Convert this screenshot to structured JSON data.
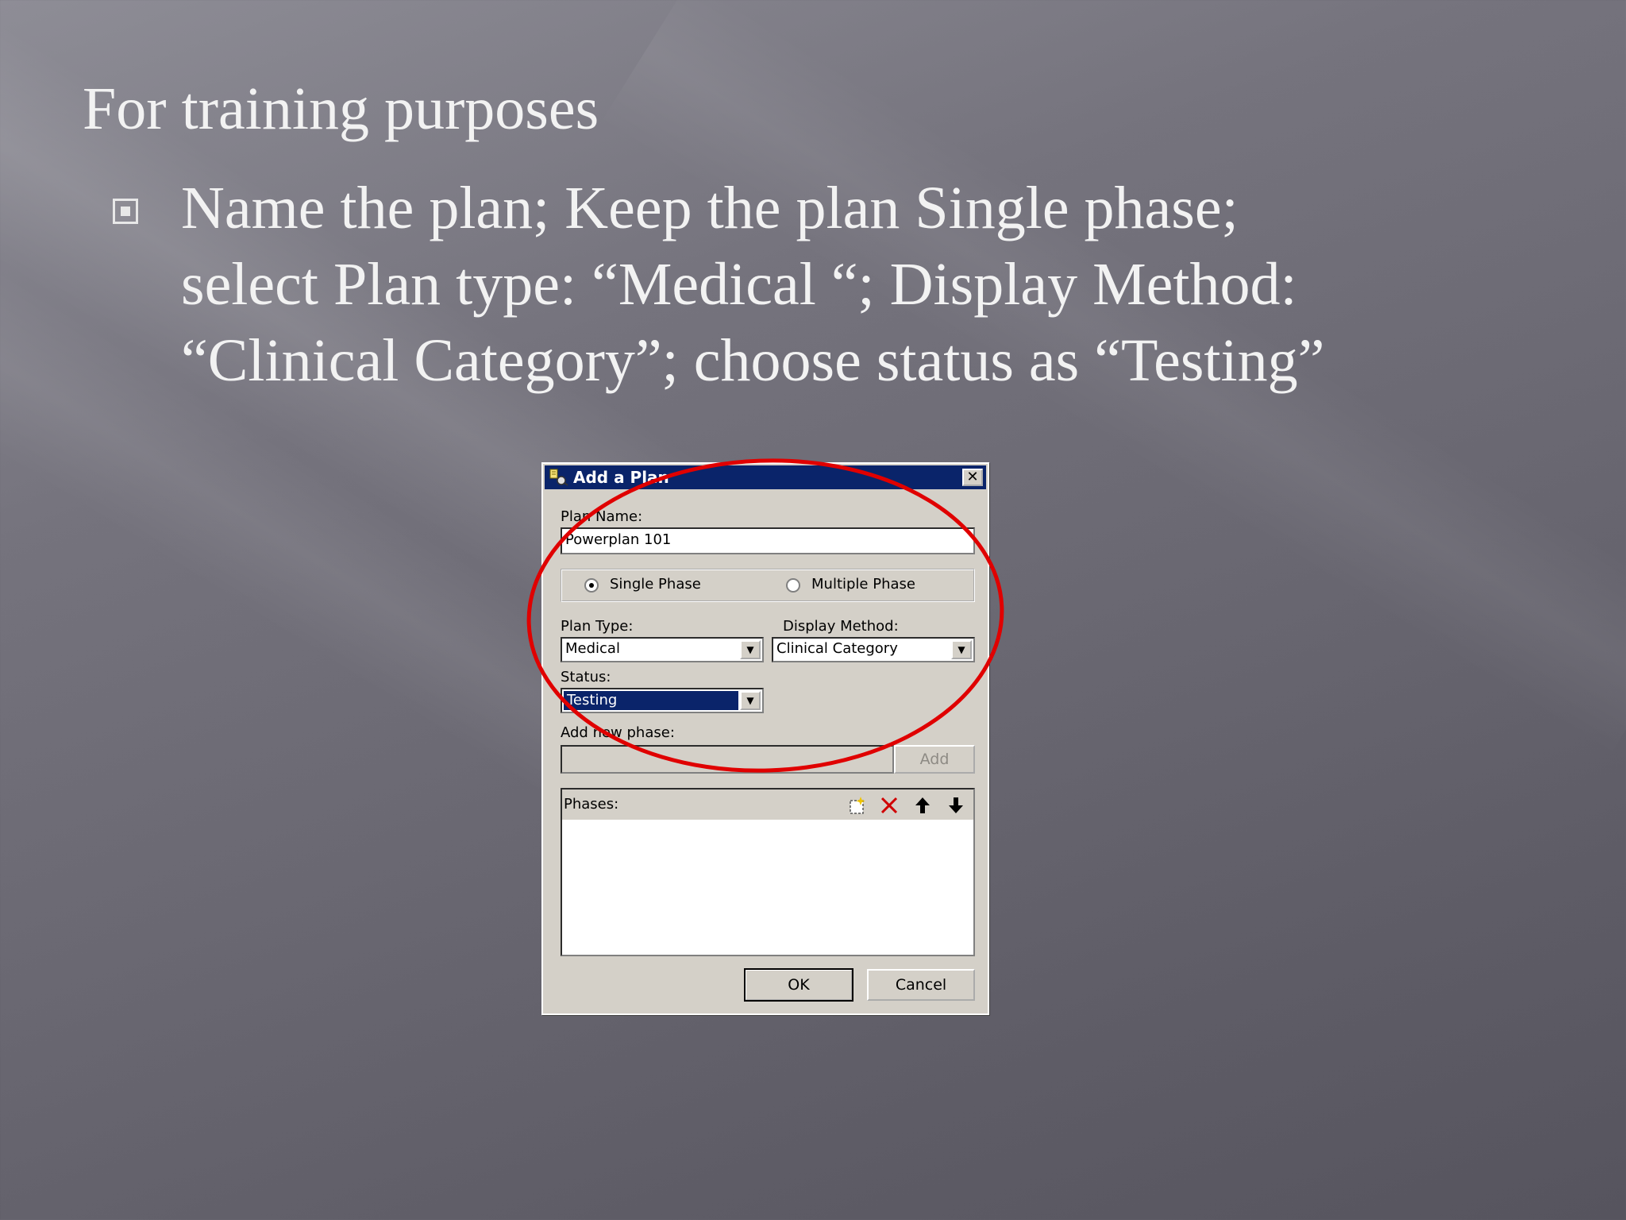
{
  "slide": {
    "title": "For training purposes",
    "bullet_lines": [
      "Name the plan; Keep the plan Single phase;",
      "select Plan type: “Medical “; Display Method:",
      "“Clinical Category”; choose status as “Testing”"
    ]
  },
  "dialog": {
    "title": "Add a Plan",
    "plan_name_label": "Plan Name:",
    "plan_name_value": "Powerplan 101",
    "single_phase_label": "Single Phase",
    "multiple_phase_label": "Multiple Phase",
    "selected_phase_mode": "Single Phase",
    "plan_type_label": "Plan Type:",
    "plan_type_value": "Medical",
    "display_method_label": "Display Method:",
    "display_method_value": "Clinical Category",
    "status_label": "Status:",
    "status_value": "Testing",
    "add_phase_label": "Add new phase:",
    "add_phase_value": "",
    "add_button": "Add",
    "phases_label": "Phases:",
    "ok_button": "OK",
    "cancel_button": "Cancel",
    "icons": [
      "app-icon",
      "close-icon",
      "new-phase-icon",
      "delete-icon",
      "move-up-icon",
      "move-down-icon"
    ]
  },
  "colors": {
    "titlebar": "#0a246a",
    "dialog_face": "#d4d0c8",
    "annotation_ellipse": "#e00000",
    "slide_text": "#f2f2f2"
  }
}
